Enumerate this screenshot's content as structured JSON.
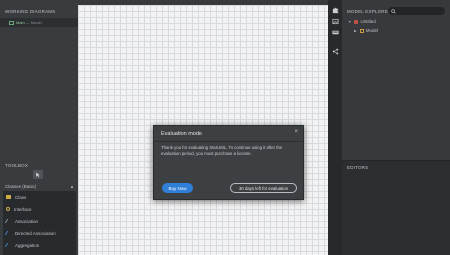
{
  "working_diagrams": {
    "title": "WORKING DIAGRAMS",
    "item_label": "Main",
    "item_sub": "— Model"
  },
  "toolbox": {
    "title": "TOOLBOX",
    "category": "Classes (Basic)",
    "items": [
      {
        "label": "Class",
        "icon": "class-icon"
      },
      {
        "label": "Interface",
        "icon": "interface-icon"
      },
      {
        "label": "Association",
        "icon": "association-icon"
      },
      {
        "label": "Directed Association",
        "icon": "directed-association-icon"
      },
      {
        "label": "Aggregation",
        "icon": "aggregation-icon"
      }
    ]
  },
  "model_explorer": {
    "title": "MODEL EXPLORER",
    "project": "Untitled",
    "model": "Model"
  },
  "editors": {
    "title": "EDITORS"
  },
  "dialog": {
    "title": "Evaluation mode",
    "close": "×",
    "body": "Thank you for evaluating StarUML. To continue using it after the evaluation period, you must purchase a license.",
    "buy_label": "Buy Now",
    "days_label": "30 days left for evaluation"
  },
  "colors": {
    "accent": "#2f7fd8",
    "panel": "#3d4043",
    "canvas_grid": "#e3e6ea"
  }
}
